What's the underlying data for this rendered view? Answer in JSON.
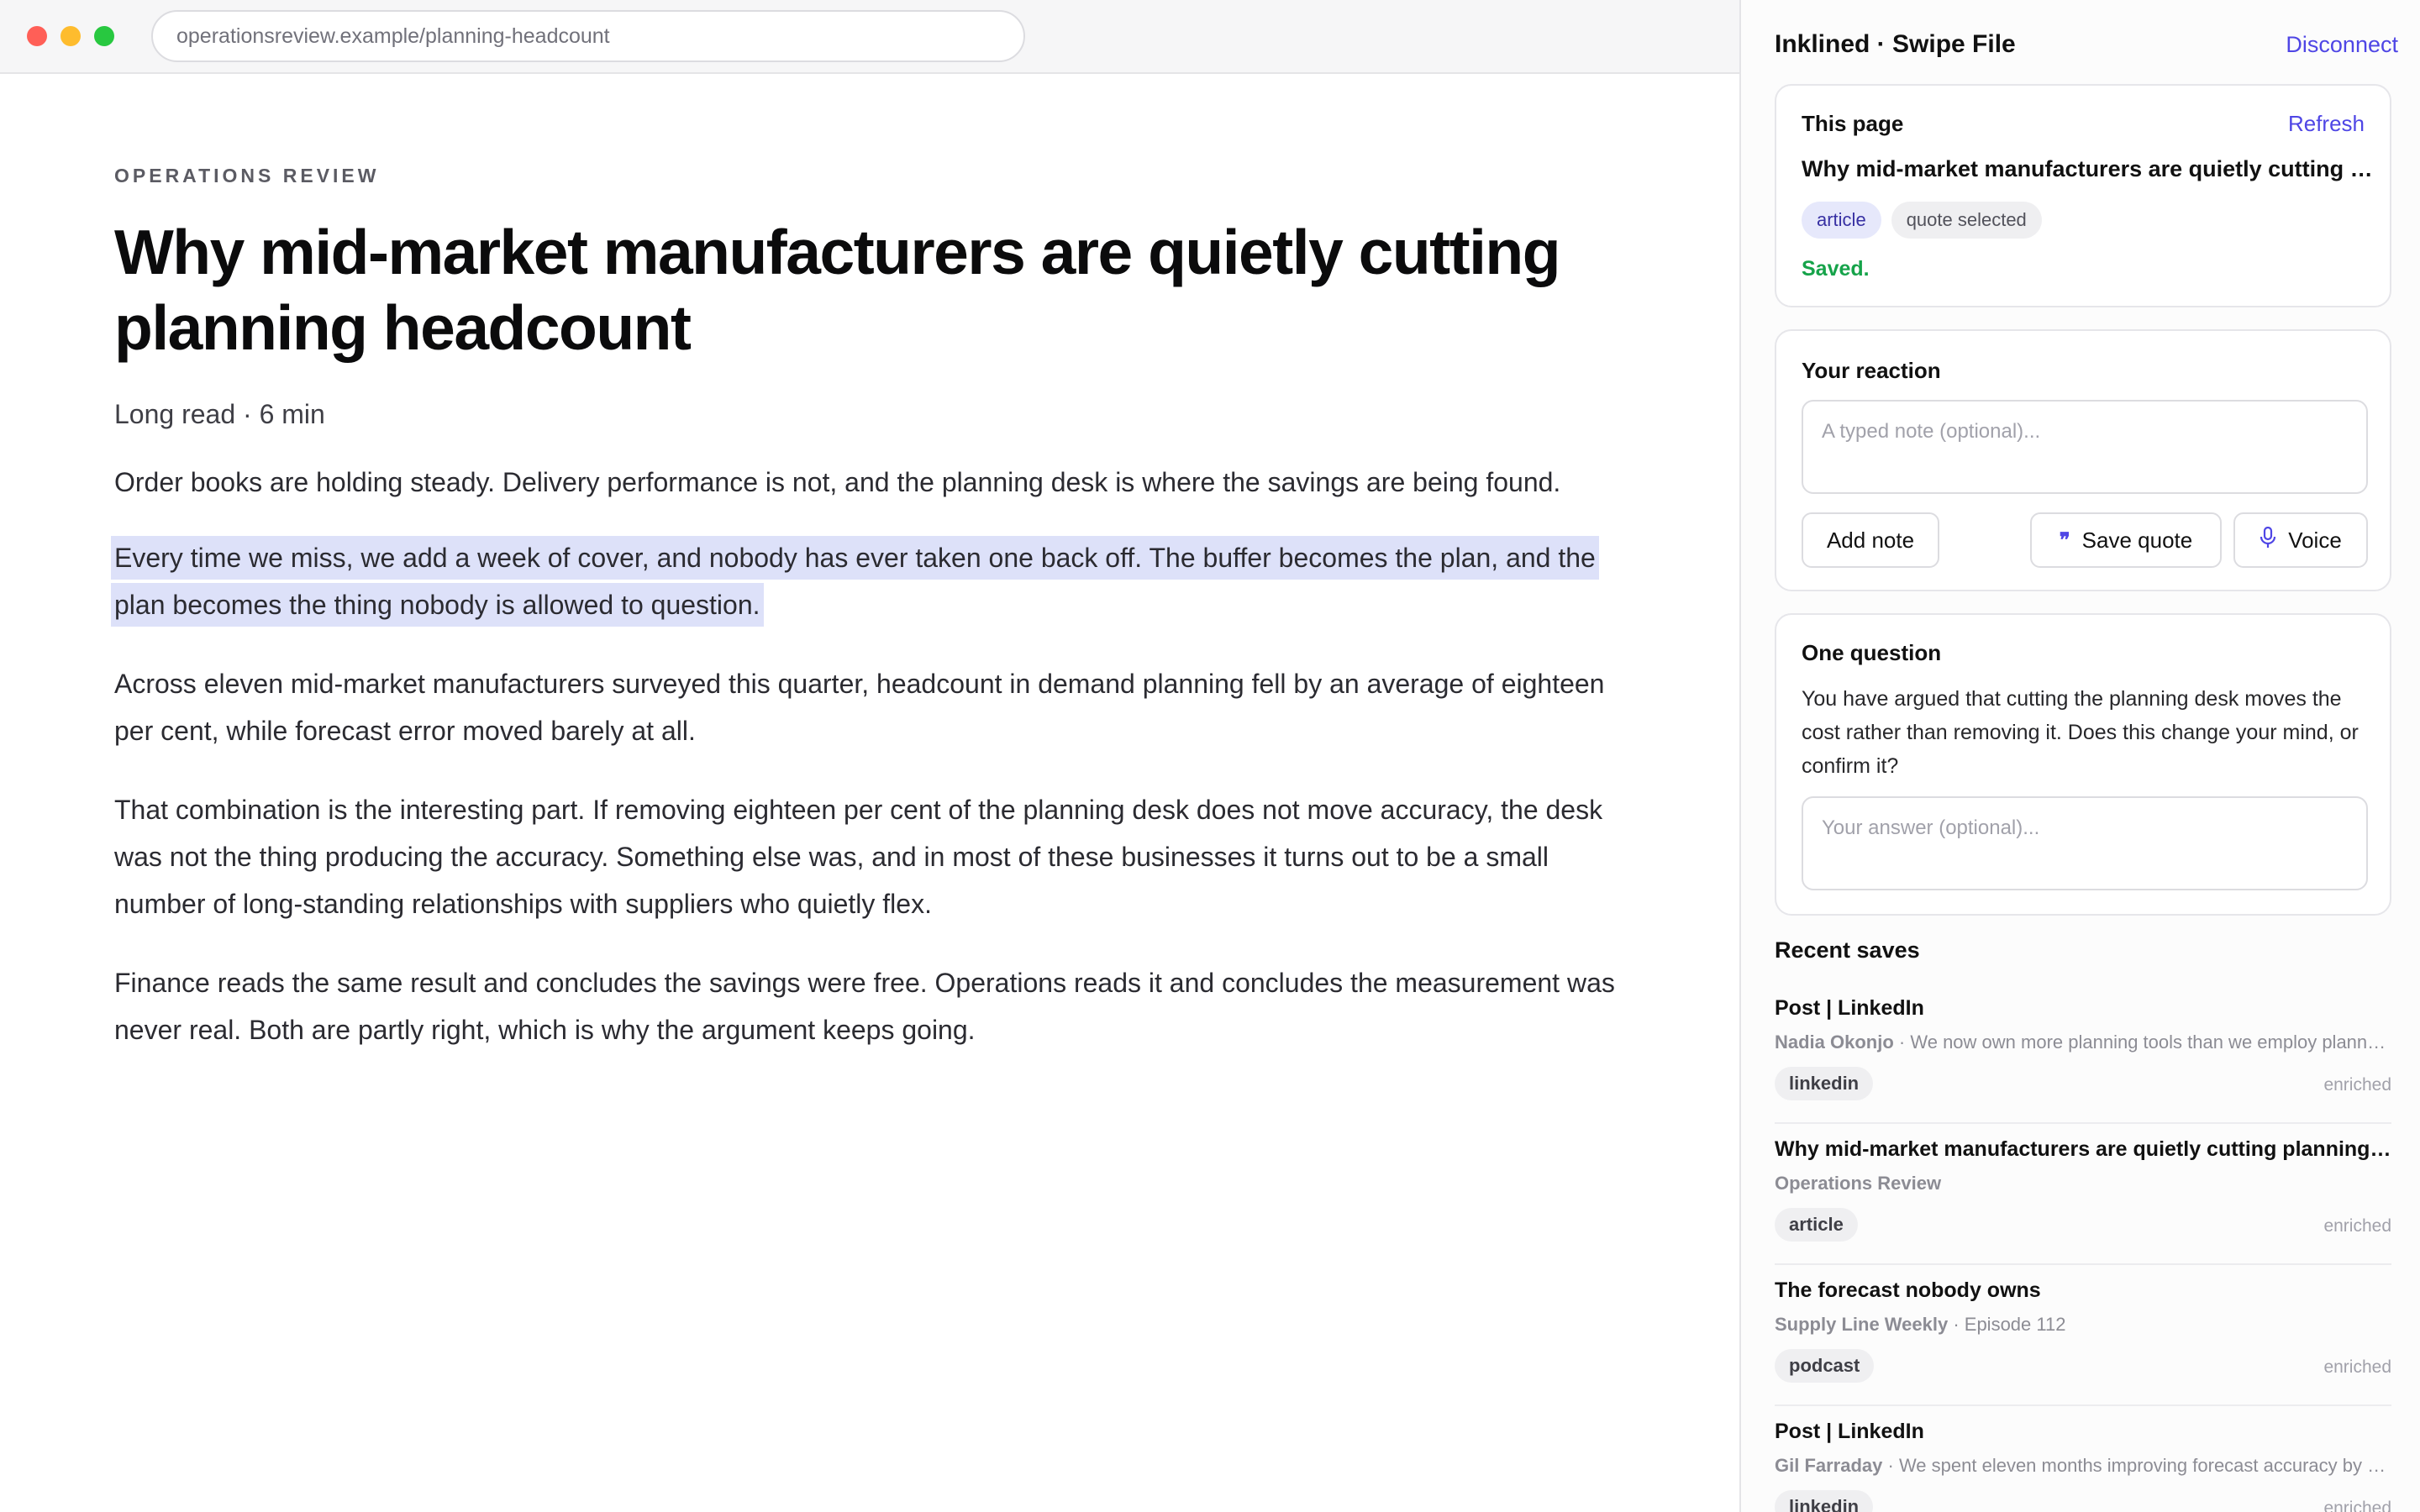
{
  "browser": {
    "url": "operationsreview.example/planning-headcount"
  },
  "article": {
    "kicker": "OPERATIONS REVIEW",
    "title": "Why mid-market manufacturers are quietly cutting planning headcount",
    "meta": "Long read · 6 min",
    "paragraphs": [
      "Order books are holding steady. Delivery performance is not, and the planning desk is where the savings are being found.",
      "Every time we miss, we add a week of cover, and nobody has ever taken one back off. The buffer becomes the plan, and the plan becomes the thing nobody is allowed to question.",
      "Across eleven mid-market manufacturers surveyed this quarter, headcount in demand planning fell by an average of eighteen per cent, while forecast error moved barely at all.",
      "That combination is the interesting part. If removing eighteen per cent of the planning desk does not move accuracy, the desk was not the thing producing the accuracy. Something else was, and in most of these businesses it turns out to be a small number of long-standing relationships with suppliers who quietly flex.",
      "Finance reads the same result and concludes the savings were free. Operations reads it and concludes the measurement was never real. Both are partly right, which is why the argument keeps going."
    ],
    "highlight_color": "#dde1f9"
  },
  "panel": {
    "title": "Inklined · Swipe File",
    "disconnect_label": "Disconnect",
    "this_page": {
      "heading": "This page",
      "refresh_label": "Refresh",
      "page_title": "Why mid-market manufacturers are quietly cutting planning headcount",
      "chips": [
        "article",
        "quote selected"
      ],
      "status": "Saved."
    },
    "reaction": {
      "heading": "Your reaction",
      "placeholder": "A typed note (optional)...",
      "add_note_label": "Add note",
      "save_quote_label": "Save quote",
      "voice_label": "Voice"
    },
    "question": {
      "heading": "One question",
      "text": "You have argued that cutting the planning desk moves the cost rather than removing it. Does this change your mind, or confirm it?",
      "placeholder": "Your answer (optional)..."
    },
    "recent": {
      "heading": "Recent saves",
      "items": [
        {
          "title": "Post | LinkedIn",
          "source": "Nadia Okonjo",
          "detail": " · We now own more planning tools than we employ planners",
          "tag": "linkedin",
          "status": "enriched"
        },
        {
          "title": "Why mid-market manufacturers are quietly cutting planning headcount",
          "source": "Operations Review",
          "detail": "",
          "tag": "article",
          "status": "enriched"
        },
        {
          "title": "The forecast nobody owns",
          "source": "Supply Line Weekly",
          "detail": " · Episode 112",
          "tag": "podcast",
          "status": "enriched"
        },
        {
          "title": "Post | LinkedIn",
          "source": "Gil Farraday",
          "detail": " · We spent eleven months improving forecast accuracy by a few points",
          "tag": "linkedin",
          "status": "enriched"
        }
      ]
    },
    "accent_color": "#4f46e5",
    "success_color": "#16a34a"
  }
}
